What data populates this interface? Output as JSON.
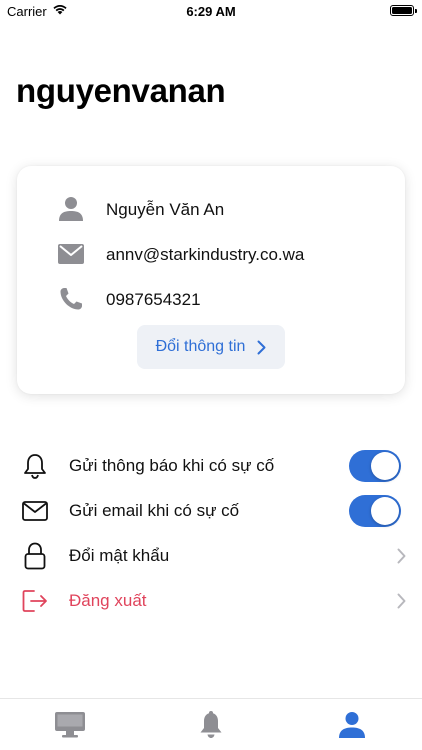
{
  "status_bar": {
    "carrier": "Carrier",
    "time": "6:29 AM"
  },
  "header": {
    "username": "nguyenvanan"
  },
  "profile": {
    "name": "Nguyễn Văn An",
    "email": "annv@starkindustry.co.wa",
    "phone": "0987654321",
    "edit_label": "Đổi thông tin"
  },
  "settings": {
    "notify_label": "Gửi thông báo khi có sự cố",
    "notify_on": true,
    "email_label": "Gửi email khi có sự cố",
    "email_on": true,
    "password_label": "Đổi mật khẩu",
    "logout_label": "Đăng xuất"
  },
  "tabs": [
    {
      "icon": "monitor-icon",
      "active": false
    },
    {
      "icon": "bell-icon",
      "active": false
    },
    {
      "icon": "person-icon",
      "active": true
    }
  ],
  "colors": {
    "accent": "#2f6fd6",
    "danger": "#e0445c",
    "icon_gray": "#8e8e93"
  }
}
